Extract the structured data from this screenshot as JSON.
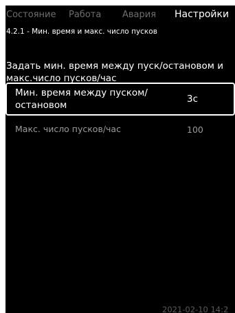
{
  "tabs": [
    {
      "label": "Состояние"
    },
    {
      "label": "Работа"
    },
    {
      "label": "Авария"
    },
    {
      "label": "Настройки"
    }
  ],
  "breadcrumb": "4.2.1 - Мин. время и макс. число пусков",
  "description": "Задать мин. время между пуск/остановом и макс.число пусков/час",
  "params": [
    {
      "label": "Мин. время между пуском/остановом",
      "value": "3с"
    },
    {
      "label": "Макс. число пусков/час",
      "value": "100"
    }
  ],
  "footer": {
    "datetime": "2021-02-10 14:2"
  },
  "colors": {
    "background": "#000000",
    "text": "#ffffff",
    "inactive_tab": "#6e6e6e",
    "inactive_param": "#9a9a9a"
  }
}
